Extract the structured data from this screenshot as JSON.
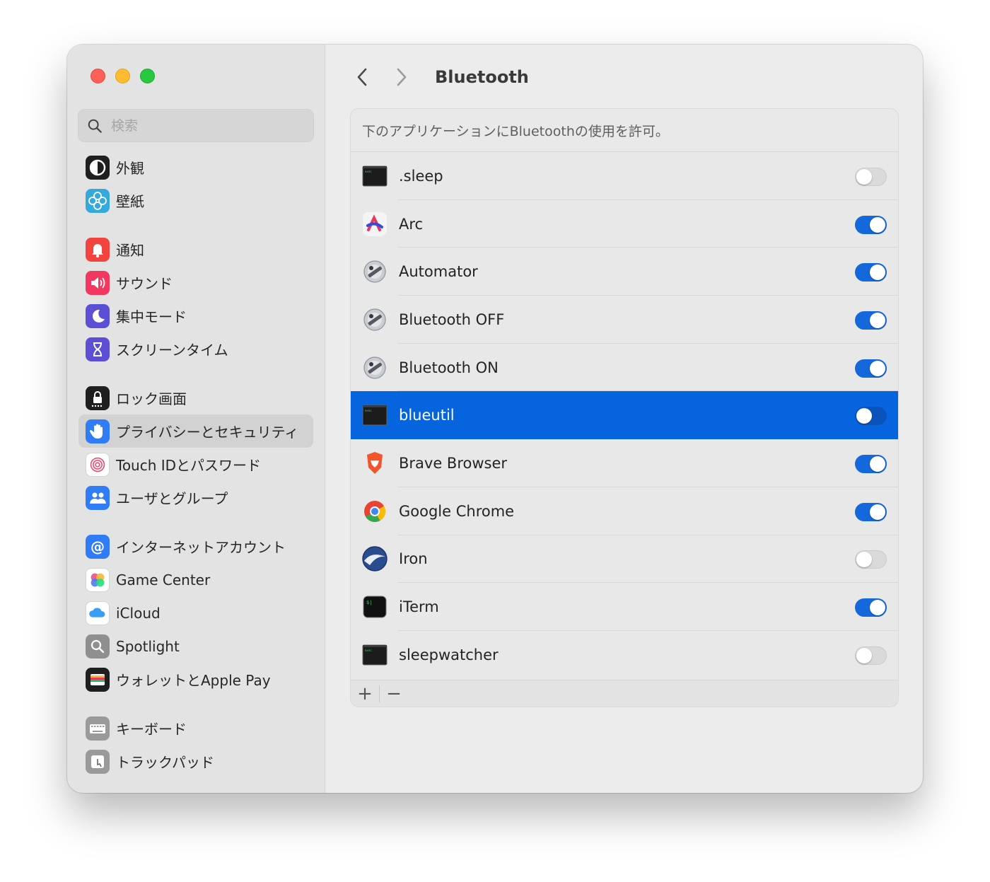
{
  "search": {
    "placeholder": "検索"
  },
  "sidebar": {
    "groups": [
      [
        {
          "label": "外観",
          "icon": "appearance-icon",
          "color": "#1f1f1f"
        },
        {
          "label": "壁紙",
          "icon": "wallpaper-icon",
          "color": "#34aadc"
        }
      ],
      [
        {
          "label": "通知",
          "icon": "bell-icon",
          "color": "#f2433f"
        },
        {
          "label": "サウンド",
          "icon": "speaker-icon",
          "color": "#f4375e"
        },
        {
          "label": "集中モード",
          "icon": "moon-icon",
          "color": "#5b4fd6"
        },
        {
          "label": "スクリーンタイム",
          "icon": "hourglass-icon",
          "color": "#5b4fd6"
        }
      ],
      [
        {
          "label": "ロック画面",
          "icon": "lock-screen-icon",
          "color": "#1f1f1f"
        },
        {
          "label": "プライバシーとセキュリティ",
          "icon": "hand-icon",
          "color": "#2f7cf6",
          "selected": true
        },
        {
          "label": "Touch IDとパスワード",
          "icon": "fingerprint-icon",
          "color": "#ffffff"
        },
        {
          "label": "ユーザとグループ",
          "icon": "users-icon",
          "color": "#2f7cf6"
        }
      ],
      [
        {
          "label": "インターネットアカウント",
          "icon": "at-icon",
          "color": "#2f7cf6"
        },
        {
          "label": "Game Center",
          "icon": "game-center-icon",
          "color": "#ffffff"
        },
        {
          "label": "iCloud",
          "icon": "cloud-icon",
          "color": "#ffffff"
        },
        {
          "label": "Spotlight",
          "icon": "spotlight-icon",
          "color": "#8f8f8f"
        },
        {
          "label": "ウォレットとApple Pay",
          "icon": "wallet-icon",
          "color": "#1f1f1f"
        }
      ],
      [
        {
          "label": "キーボード",
          "icon": "keyboard-icon",
          "color": "#9a9a9a"
        },
        {
          "label": "トラックパッド",
          "icon": "trackpad-icon",
          "color": "#9a9a9a"
        }
      ]
    ]
  },
  "main": {
    "title": "Bluetooth",
    "header": "下のアプリケーションにBluetoothの使用を許可。",
    "apps": [
      {
        "name": ".sleep",
        "icon": "terminal-icon",
        "enabled": false
      },
      {
        "name": "Arc",
        "icon": "arc-icon",
        "enabled": true
      },
      {
        "name": "Automator",
        "icon": "automator-icon",
        "enabled": true
      },
      {
        "name": "Bluetooth OFF",
        "icon": "automator-icon",
        "enabled": true
      },
      {
        "name": "Bluetooth ON",
        "icon": "automator-icon",
        "enabled": true
      },
      {
        "name": "blueutil",
        "icon": "terminal-icon",
        "enabled": false,
        "selected": true
      },
      {
        "name": "Brave Browser",
        "icon": "brave-icon",
        "enabled": true
      },
      {
        "name": "Google Chrome",
        "icon": "chrome-icon",
        "enabled": true
      },
      {
        "name": "Iron",
        "icon": "iron-icon",
        "enabled": false
      },
      {
        "name": "iTerm",
        "icon": "iterm-icon",
        "enabled": true
      },
      {
        "name": "sleepwatcher",
        "icon": "terminal-icon",
        "enabled": false
      }
    ],
    "footer": {
      "add": "+",
      "remove": "−"
    }
  }
}
